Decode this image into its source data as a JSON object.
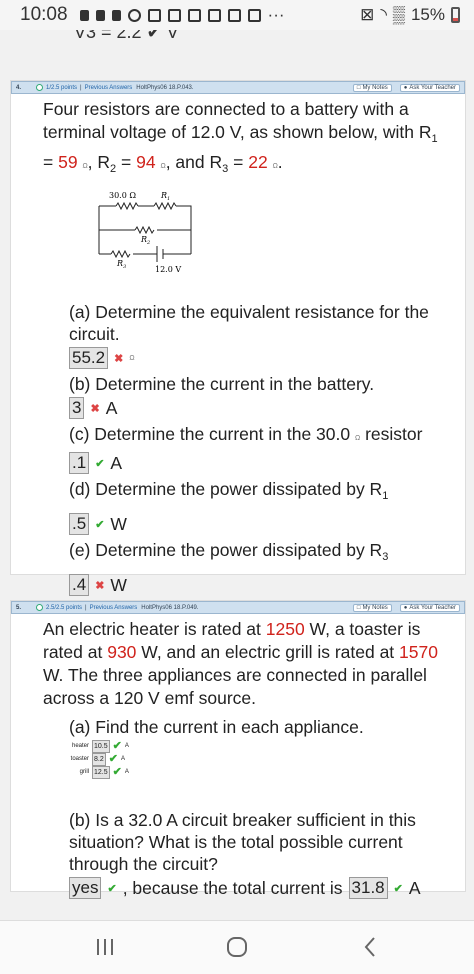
{
  "status": {
    "time": "10:08",
    "battery": "15%",
    "dots": "···"
  },
  "top_cut_text": "V3 = 2.2 ✔ V",
  "q4": {
    "number": "4.",
    "points": "1/2.5 points",
    "prev": "Previous Answers",
    "id": "HoltPhys06 18.P.043.",
    "notes": "My Notes",
    "ask": "Ask Your Teacher",
    "prompt_1": "Four resistors are connected to a battery with a terminal voltage of 12.0 V, as shown below, with R",
    "r1_sub": "1",
    "eq1": "= ",
    "r1_val": "59",
    "r2_label": ", R",
    "r2_sub": "2",
    "eq2": " = ",
    "r2_val": "94",
    "r3_label": ", and R",
    "r3_sub": "3",
    "eq3": " = ",
    "r3_val": "22",
    "unit": "Ω",
    "diagram": {
      "top_res": "30.0 Ω",
      "r1": "R",
      "r1s": "1",
      "r2": "R",
      "r2s": "2",
      "r3": "R",
      "r3s": "3",
      "volt": "12.0 V"
    },
    "a_text": "(a) Determine the equivalent resistance for the circuit.",
    "a_ans": "55.2",
    "b_text": "(b) Determine the current in the battery.",
    "b_ans": "3",
    "b_unit": "A",
    "c_text": "(c) Determine the current in the 30.0",
    "c_text2": " resistor",
    "c_ans": ".1",
    "c_unit": "A",
    "d_text": "(d) Determine the power dissipated by R",
    "d_sub": "1",
    "d_ans": ".5",
    "d_unit": "W",
    "e_text": "(e) Determine the power dissipated by R",
    "e_sub": "3",
    "e_ans": ".4",
    "e_unit": "W"
  },
  "q5": {
    "number": "5.",
    "points": "2.5/2.5 points",
    "prev": "Previous Answers",
    "id": "HoltPhys06 18.P.049.",
    "notes": "My Notes",
    "ask": "Ask Your Teacher",
    "p1": "An electric heater is rated at ",
    "heater_w": "1250",
    "p2": " W, a toaster is rated at ",
    "toaster_w": "930",
    "p3": " W, and an electric grill is rated at ",
    "grill_w": "1570",
    "p4": " W. The three appliances are connected in parallel across a 120 V emf source.",
    "a_text": "(a) Find the current in each appliance.",
    "rows": [
      {
        "label": "heater",
        "value": "10.5",
        "unit": "A"
      },
      {
        "label": "toaster",
        "value": "8.2",
        "unit": "A"
      },
      {
        "label": "grill",
        "value": "12.5",
        "unit": "A"
      }
    ],
    "b_text": "(b) Is a 32.0 A circuit breaker sufficient in this situation? What is the total possible current through the circuit?",
    "b_ans1": "yes",
    "b_mid": ", because the total current is",
    "b_ans2": "31.8",
    "b_unit": "A"
  }
}
